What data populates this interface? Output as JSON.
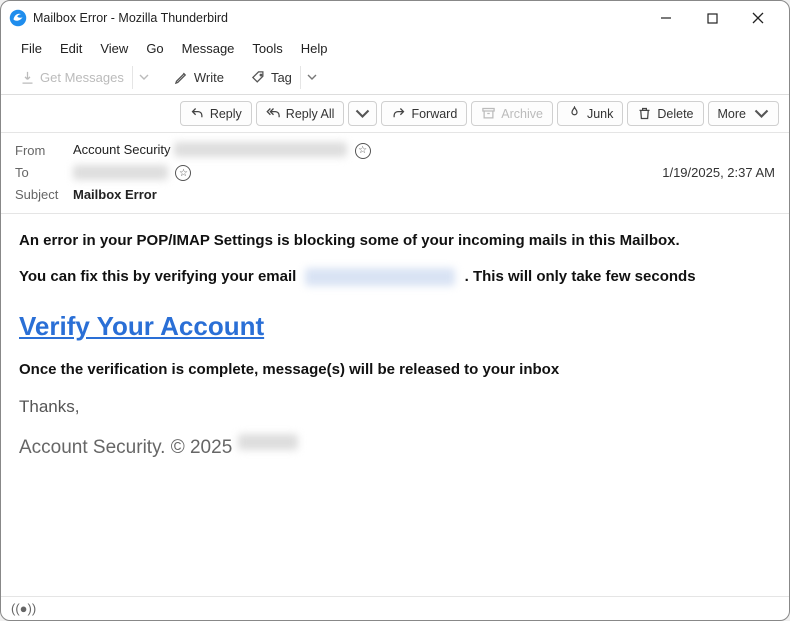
{
  "window": {
    "title": "Mailbox Error - Mozilla Thunderbird"
  },
  "menu": {
    "file": "File",
    "edit": "Edit",
    "view": "View",
    "go": "Go",
    "message": "Message",
    "tools": "Tools",
    "help": "Help"
  },
  "toolbar": {
    "get_messages": "Get Messages",
    "write": "Write",
    "tag": "Tag"
  },
  "msgbar": {
    "reply": "Reply",
    "reply_all": "Reply All",
    "forward": "Forward",
    "archive": "Archive",
    "junk": "Junk",
    "delete": "Delete",
    "more": "More"
  },
  "headers": {
    "from_label": "From",
    "from_value": "Account Security",
    "to_label": "To",
    "subject_label": "Subject",
    "subject_value": "Mailbox Error",
    "date": "1/19/2025, 2:37 AM"
  },
  "body": {
    "p1": "An error in your POP/IMAP Settings is blocking some of your incoming mails in this Mailbox.",
    "p2a": "You can fix this by verifying your email",
    "p2b": ". This will only take few seconds",
    "verify": "Verify Your Account",
    "p3": "Once the verification is complete, message(s) will be released to your inbox",
    "thanks": "Thanks,",
    "sig": "Account Security. © 2025"
  }
}
